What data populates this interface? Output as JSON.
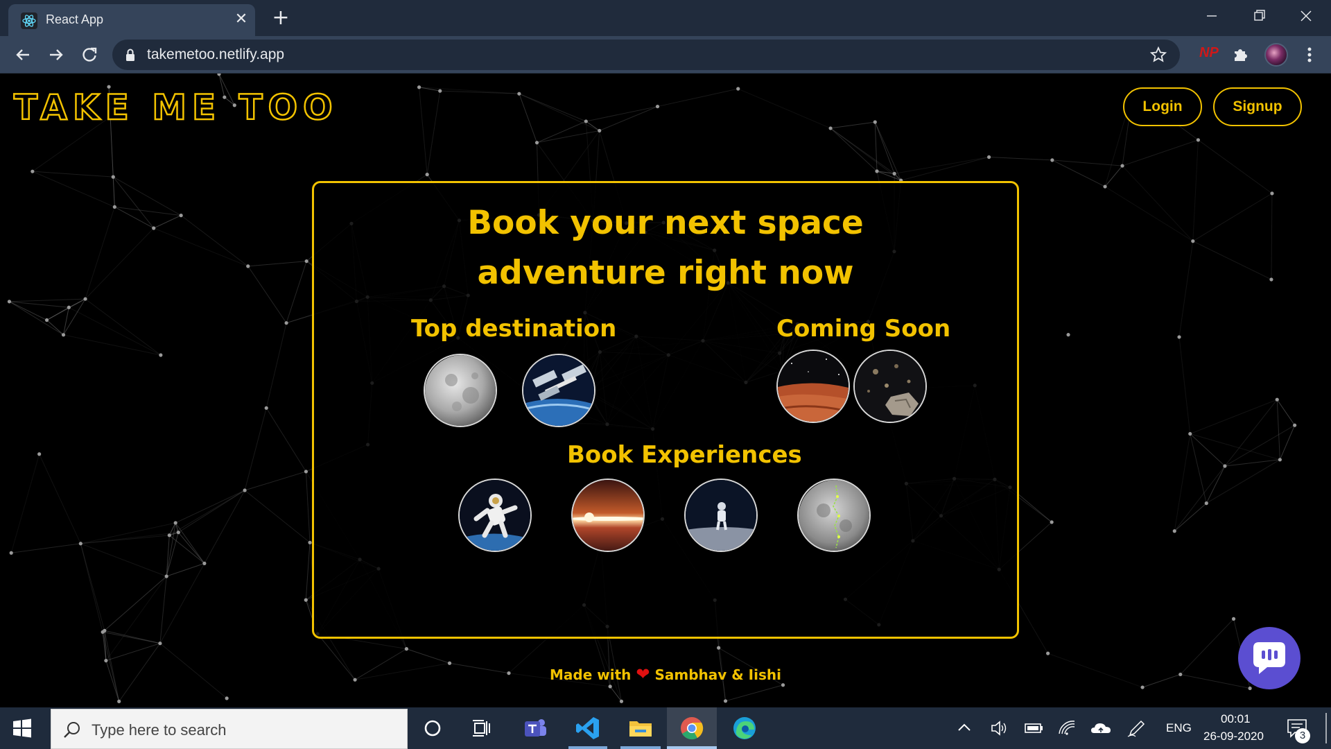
{
  "browser": {
    "tab_title": "React App",
    "tab_close": "✕",
    "new_tab": "+",
    "url": "takemetoo.netlify.app",
    "extension_label": "NP"
  },
  "page": {
    "logo": "TAKE ME TOO",
    "login_label": "Login",
    "signup_label": "Signup",
    "headline_line1": "Book your next space",
    "headline_line2": "adventure right now",
    "sections": {
      "top_destination": "Top destination",
      "coming_soon": "Coming Soon",
      "book_experiences": "Book Experiences"
    },
    "footer": {
      "made_with": "Made with",
      "heart": "❤",
      "authors": "Sambhav & Iishi"
    }
  },
  "taskbar": {
    "search_placeholder": "Type here to search",
    "language": "ENG",
    "time": "00:01",
    "date": "26-09-2020",
    "notification_count": "3"
  },
  "colors": {
    "accent": "#f2c200",
    "chrome_dark": "#202b3c",
    "chrome_tab": "#35445a",
    "chat_button": "#5b4ed1"
  }
}
